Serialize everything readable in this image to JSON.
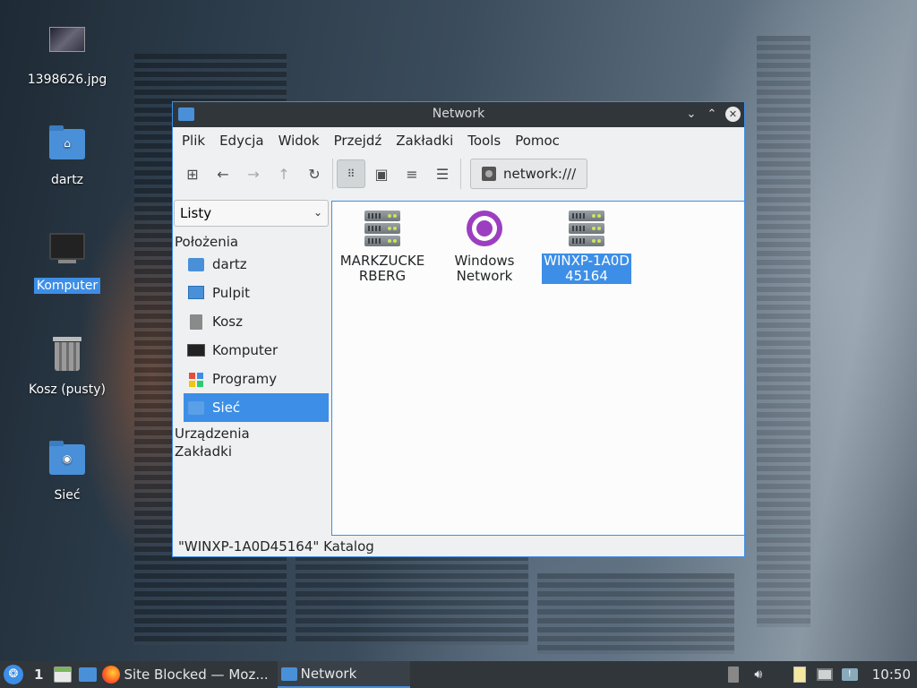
{
  "desktop": {
    "icons": [
      {
        "label": "1398626.jpg"
      },
      {
        "label": "dartz"
      },
      {
        "label": "Komputer"
      },
      {
        "label": "Kosz (pusty)"
      },
      {
        "label": "Sieć"
      }
    ]
  },
  "window": {
    "title": "Network",
    "menu": [
      "Plik",
      "Edycja",
      "Widok",
      "Przejdź",
      "Zakładki",
      "Tools",
      "Pomoc"
    ],
    "address": "network:///",
    "sidebar": {
      "mode": "Listy",
      "sections": {
        "places": "Położenia",
        "devices": "Urządzenia",
        "bookmarks": "Zakładki"
      },
      "places": [
        "dartz",
        "Pulpit",
        "Kosz",
        "Komputer",
        "Programy",
        "Sieć"
      ]
    },
    "items": [
      {
        "label": "MARKZUCKERBERG",
        "line1": "MARKZUCKE",
        "line2": "RBERG",
        "icon": "server-icon"
      },
      {
        "label": "Windows Network",
        "line1": "Windows",
        "line2": "Network",
        "icon": "network-globe-icon"
      },
      {
        "label": "WINXP-1A0D45164",
        "line1": "WINXP-1A0D",
        "line2": "45164",
        "icon": "server-icon"
      }
    ],
    "status": "\"WINXP-1A0D45164\" Katalog"
  },
  "taskbar": {
    "workspace": "1",
    "tasks": [
      "Site Blocked — Moz...",
      "Network"
    ],
    "clock": "10:50"
  },
  "colors": {
    "accent": "#3d8ee6",
    "titlebar": "#31363b",
    "window_bg": "#eff0f1"
  }
}
